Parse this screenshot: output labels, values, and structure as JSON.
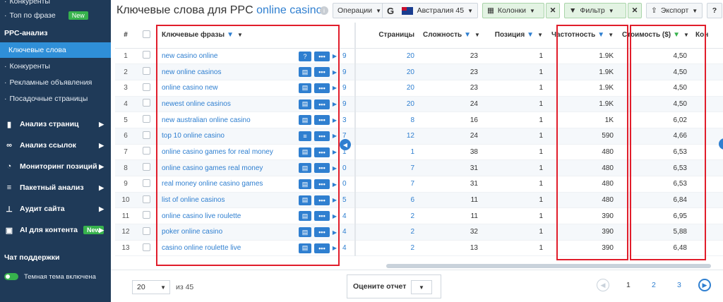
{
  "sidebar": {
    "items_top": [
      "Конкуренты",
      "Топ по фразе"
    ],
    "new_badge": "New",
    "section": "PPC-анализ",
    "sub_items": [
      "Ключевые слова",
      "Конкуренты",
      "Рекламные объявления",
      "Посадочные страницы"
    ],
    "main_items": [
      "Анализ страниц",
      "Анализ ссылок",
      "Мониторинг позиций",
      "Пакетный анализ",
      "Аудит сайта",
      "AI для контента"
    ],
    "support": "Чат поддержки",
    "theme": "Темная тема включена"
  },
  "header": {
    "title_prefix": "Ключевые слова для PPC",
    "title_keyword": "online casino",
    "operations": "Операции",
    "region": "Австралия 45",
    "columns": "Колонки",
    "filter": "Фильтр",
    "export": "Экспорт"
  },
  "table": {
    "headers": {
      "num": "#",
      "keyword": "Ключевые фразы",
      "pages": "Страницы",
      "difficulty": "Сложность",
      "position": "Позиция",
      "frequency": "Частотность",
      "cost": "Стоимость ($)",
      "next": "Кон"
    },
    "rows": [
      {
        "n": "1",
        "kw": "new casino online",
        "cut": "9",
        "pages": "20",
        "diff": "23",
        "pos": "1",
        "freq": "1.9K",
        "cost": "4,50"
      },
      {
        "n": "2",
        "kw": "new online casinos",
        "cut": "9",
        "pages": "20",
        "diff": "23",
        "pos": "1",
        "freq": "1.9K",
        "cost": "4,50"
      },
      {
        "n": "3",
        "kw": "online casino new",
        "cut": "9",
        "pages": "20",
        "diff": "23",
        "pos": "1",
        "freq": "1.9K",
        "cost": "4,50"
      },
      {
        "n": "4",
        "kw": "newest online casinos",
        "cut": "9",
        "pages": "20",
        "diff": "24",
        "pos": "1",
        "freq": "1.9K",
        "cost": "4,50"
      },
      {
        "n": "5",
        "kw": "new australian online casino",
        "cut": "3",
        "pages": "8",
        "diff": "16",
        "pos": "1",
        "freq": "1K",
        "cost": "6,02"
      },
      {
        "n": "6",
        "kw": "top 10 online casino",
        "cut": "7",
        "pages": "12",
        "diff": "24",
        "pos": "1",
        "freq": "590",
        "cost": "4,66"
      },
      {
        "n": "7",
        "kw": "online casino games for real money",
        "cut": "1",
        "pages": "1",
        "diff": "38",
        "pos": "1",
        "freq": "480",
        "cost": "6,53"
      },
      {
        "n": "8",
        "kw": "online casino games real money",
        "cut": "0",
        "pages": "7",
        "diff": "31",
        "pos": "1",
        "freq": "480",
        "cost": "6,53"
      },
      {
        "n": "9",
        "kw": "real money online casino games",
        "cut": "0",
        "pages": "7",
        "diff": "31",
        "pos": "1",
        "freq": "480",
        "cost": "6,53"
      },
      {
        "n": "10",
        "kw": "list of online casinos",
        "cut": "5",
        "pages": "6",
        "diff": "11",
        "pos": "1",
        "freq": "480",
        "cost": "6,84"
      },
      {
        "n": "11",
        "kw": "online casino live roulette",
        "cut": "4",
        "pages": "2",
        "diff": "11",
        "pos": "1",
        "freq": "390",
        "cost": "6,95"
      },
      {
        "n": "12",
        "kw": "poker online casino",
        "cut": "4",
        "pages": "2",
        "diff": "32",
        "pos": "1",
        "freq": "390",
        "cost": "5,88"
      },
      {
        "n": "13",
        "kw": "casino online roulette live",
        "cut": "4",
        "pages": "2",
        "diff": "13",
        "pos": "1",
        "freq": "390",
        "cost": "6,48"
      }
    ]
  },
  "footer": {
    "per_page": "20",
    "of_total": "из 45",
    "rate": "Оцените отчет",
    "pages": [
      "1",
      "2",
      "3"
    ]
  },
  "icons": [
    "info-icon",
    "google-icon",
    "flag-icon",
    "filter-icon",
    "export-icon",
    "question-icon",
    "more-icon",
    "ad-icon"
  ]
}
